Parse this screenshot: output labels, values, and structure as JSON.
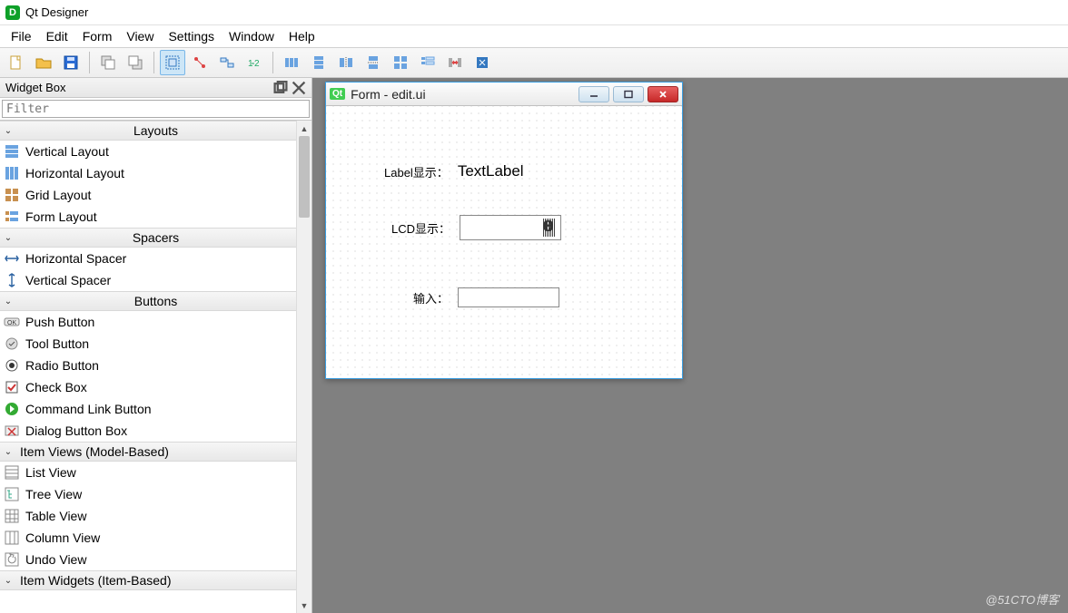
{
  "app": {
    "title": "Qt Designer"
  },
  "menu": [
    "File",
    "Edit",
    "Form",
    "View",
    "Settings",
    "Window",
    "Help"
  ],
  "toolbar": {
    "buttons": [
      {
        "name": "new-file-icon"
      },
      {
        "name": "open-file-icon"
      },
      {
        "name": "save-file-icon"
      },
      {
        "sep": true
      },
      {
        "name": "send-back-icon"
      },
      {
        "name": "bring-front-icon"
      },
      {
        "sep": true
      },
      {
        "name": "edit-widgets-icon",
        "active": true
      },
      {
        "name": "edit-signals-icon"
      },
      {
        "name": "edit-buddies-icon"
      },
      {
        "name": "edit-tab-order-icon"
      },
      {
        "sep": true
      },
      {
        "name": "layout-horizontal-icon"
      },
      {
        "name": "layout-vertical-icon"
      },
      {
        "name": "layout-h-splitter-icon"
      },
      {
        "name": "layout-v-splitter-icon"
      },
      {
        "name": "layout-grid-icon"
      },
      {
        "name": "layout-form-icon"
      },
      {
        "name": "break-layout-icon"
      },
      {
        "name": "adjust-size-icon"
      }
    ]
  },
  "widgetbox": {
    "title": "Widget Box",
    "filter_placeholder": "Filter",
    "categories": [
      {
        "name": "Layouts",
        "items": [
          {
            "icon": "vlayout",
            "label": "Vertical Layout"
          },
          {
            "icon": "hlayout",
            "label": "Horizontal Layout"
          },
          {
            "icon": "gridlayout",
            "label": "Grid Layout"
          },
          {
            "icon": "formlayout",
            "label": "Form Layout"
          }
        ]
      },
      {
        "name": "Spacers",
        "items": [
          {
            "icon": "hspacer",
            "label": "Horizontal Spacer"
          },
          {
            "icon": "vspacer",
            "label": "Vertical Spacer"
          }
        ]
      },
      {
        "name": "Buttons",
        "items": [
          {
            "icon": "pushbtn",
            "label": "Push Button"
          },
          {
            "icon": "toolbtn",
            "label": "Tool Button"
          },
          {
            "icon": "radiobtn",
            "label": "Radio Button"
          },
          {
            "icon": "checkbox",
            "label": "Check Box"
          },
          {
            "icon": "cmdlink",
            "label": "Command Link Button"
          },
          {
            "icon": "dlgbox",
            "label": "Dialog Button Box"
          }
        ]
      },
      {
        "name": "Item Views (Model-Based)",
        "items": [
          {
            "icon": "listview",
            "label": "List View"
          },
          {
            "icon": "treeview",
            "label": "Tree View"
          },
          {
            "icon": "tableview",
            "label": "Table View"
          },
          {
            "icon": "columnview",
            "label": "Column View"
          },
          {
            "icon": "undoview",
            "label": "Undo View"
          }
        ]
      },
      {
        "name": "Item Widgets (Item-Based)",
        "items": []
      }
    ]
  },
  "form": {
    "title": "Form - edit.ui",
    "rows": {
      "label_caption": "Label显示：",
      "label_value": "TextLabel",
      "lcd_caption": "LCD显示：",
      "lcd_value": "0",
      "input_caption": "输入：",
      "input_value": ""
    }
  },
  "watermark": "@51CTO博客"
}
